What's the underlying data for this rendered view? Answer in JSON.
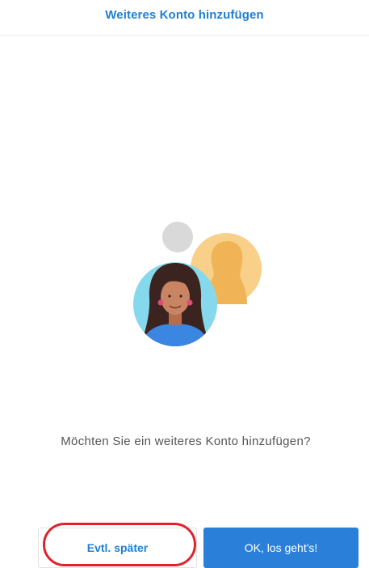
{
  "header": {
    "title": "Weiteres Konto hinzufügen"
  },
  "illustration": {
    "icons": [
      "small-gray-circle",
      "silhouette-avatar-icon",
      "woman-avatar-icon"
    ]
  },
  "message": {
    "text": "Möchten Sie ein weiteres Konto hinzufügen?"
  },
  "actions": {
    "later_label": "Evtl. später",
    "ok_label": "OK, los geht's!"
  },
  "colors": {
    "accent": "#1f7fd4",
    "primary_button": "#2a7fd8",
    "highlight": "#e0232b"
  }
}
